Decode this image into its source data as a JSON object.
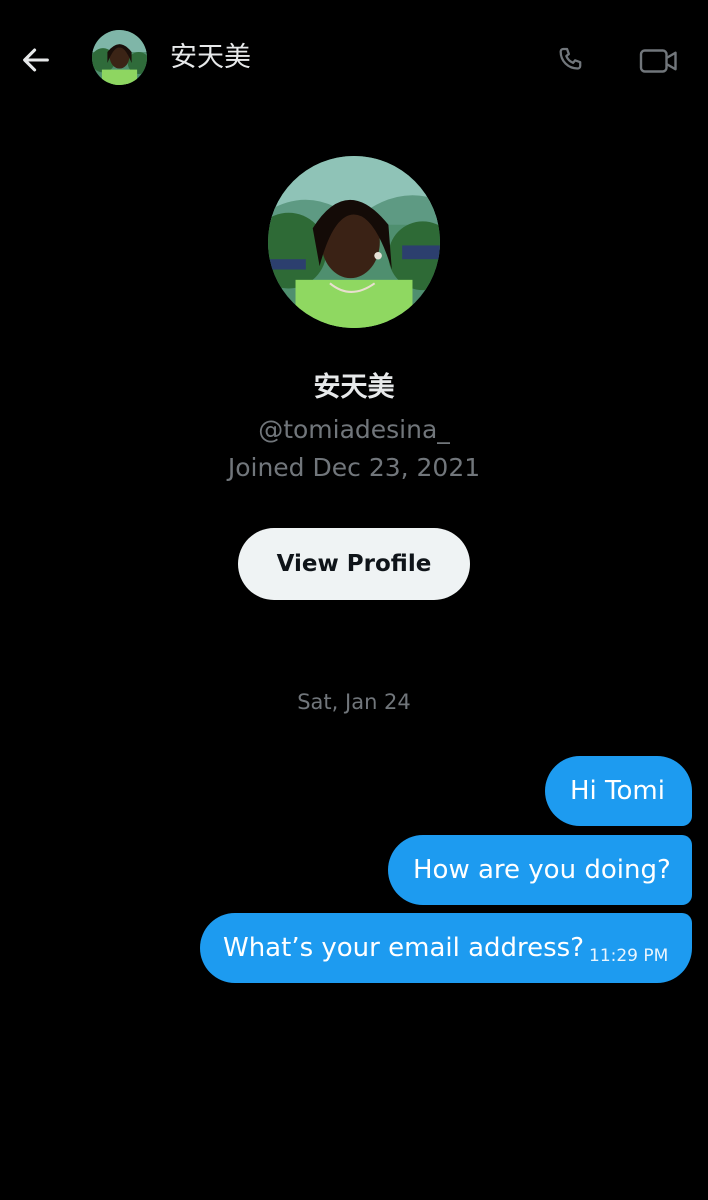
{
  "header": {
    "back_icon": "arrow-left-icon",
    "name": "安天美",
    "call_icon": "phone-icon",
    "video_icon": "video-camera-icon"
  },
  "profile": {
    "name": "安天美",
    "handle": "@tomiadesina_",
    "joined": "Joined Dec 23, 2021",
    "view_profile_label": "View Profile"
  },
  "conversation": {
    "date_divider": "Sat, Jan 24",
    "messages": [
      {
        "text": "Hi Tomi",
        "time": ""
      },
      {
        "text": "How are you doing?",
        "time": ""
      },
      {
        "text": "What’s your email address?",
        "time": "11:29 PM"
      }
    ]
  },
  "colors": {
    "background": "#000000",
    "bubble": "#1d9bf0",
    "secondary_text": "#71767b",
    "button_bg": "#eff3f4"
  }
}
